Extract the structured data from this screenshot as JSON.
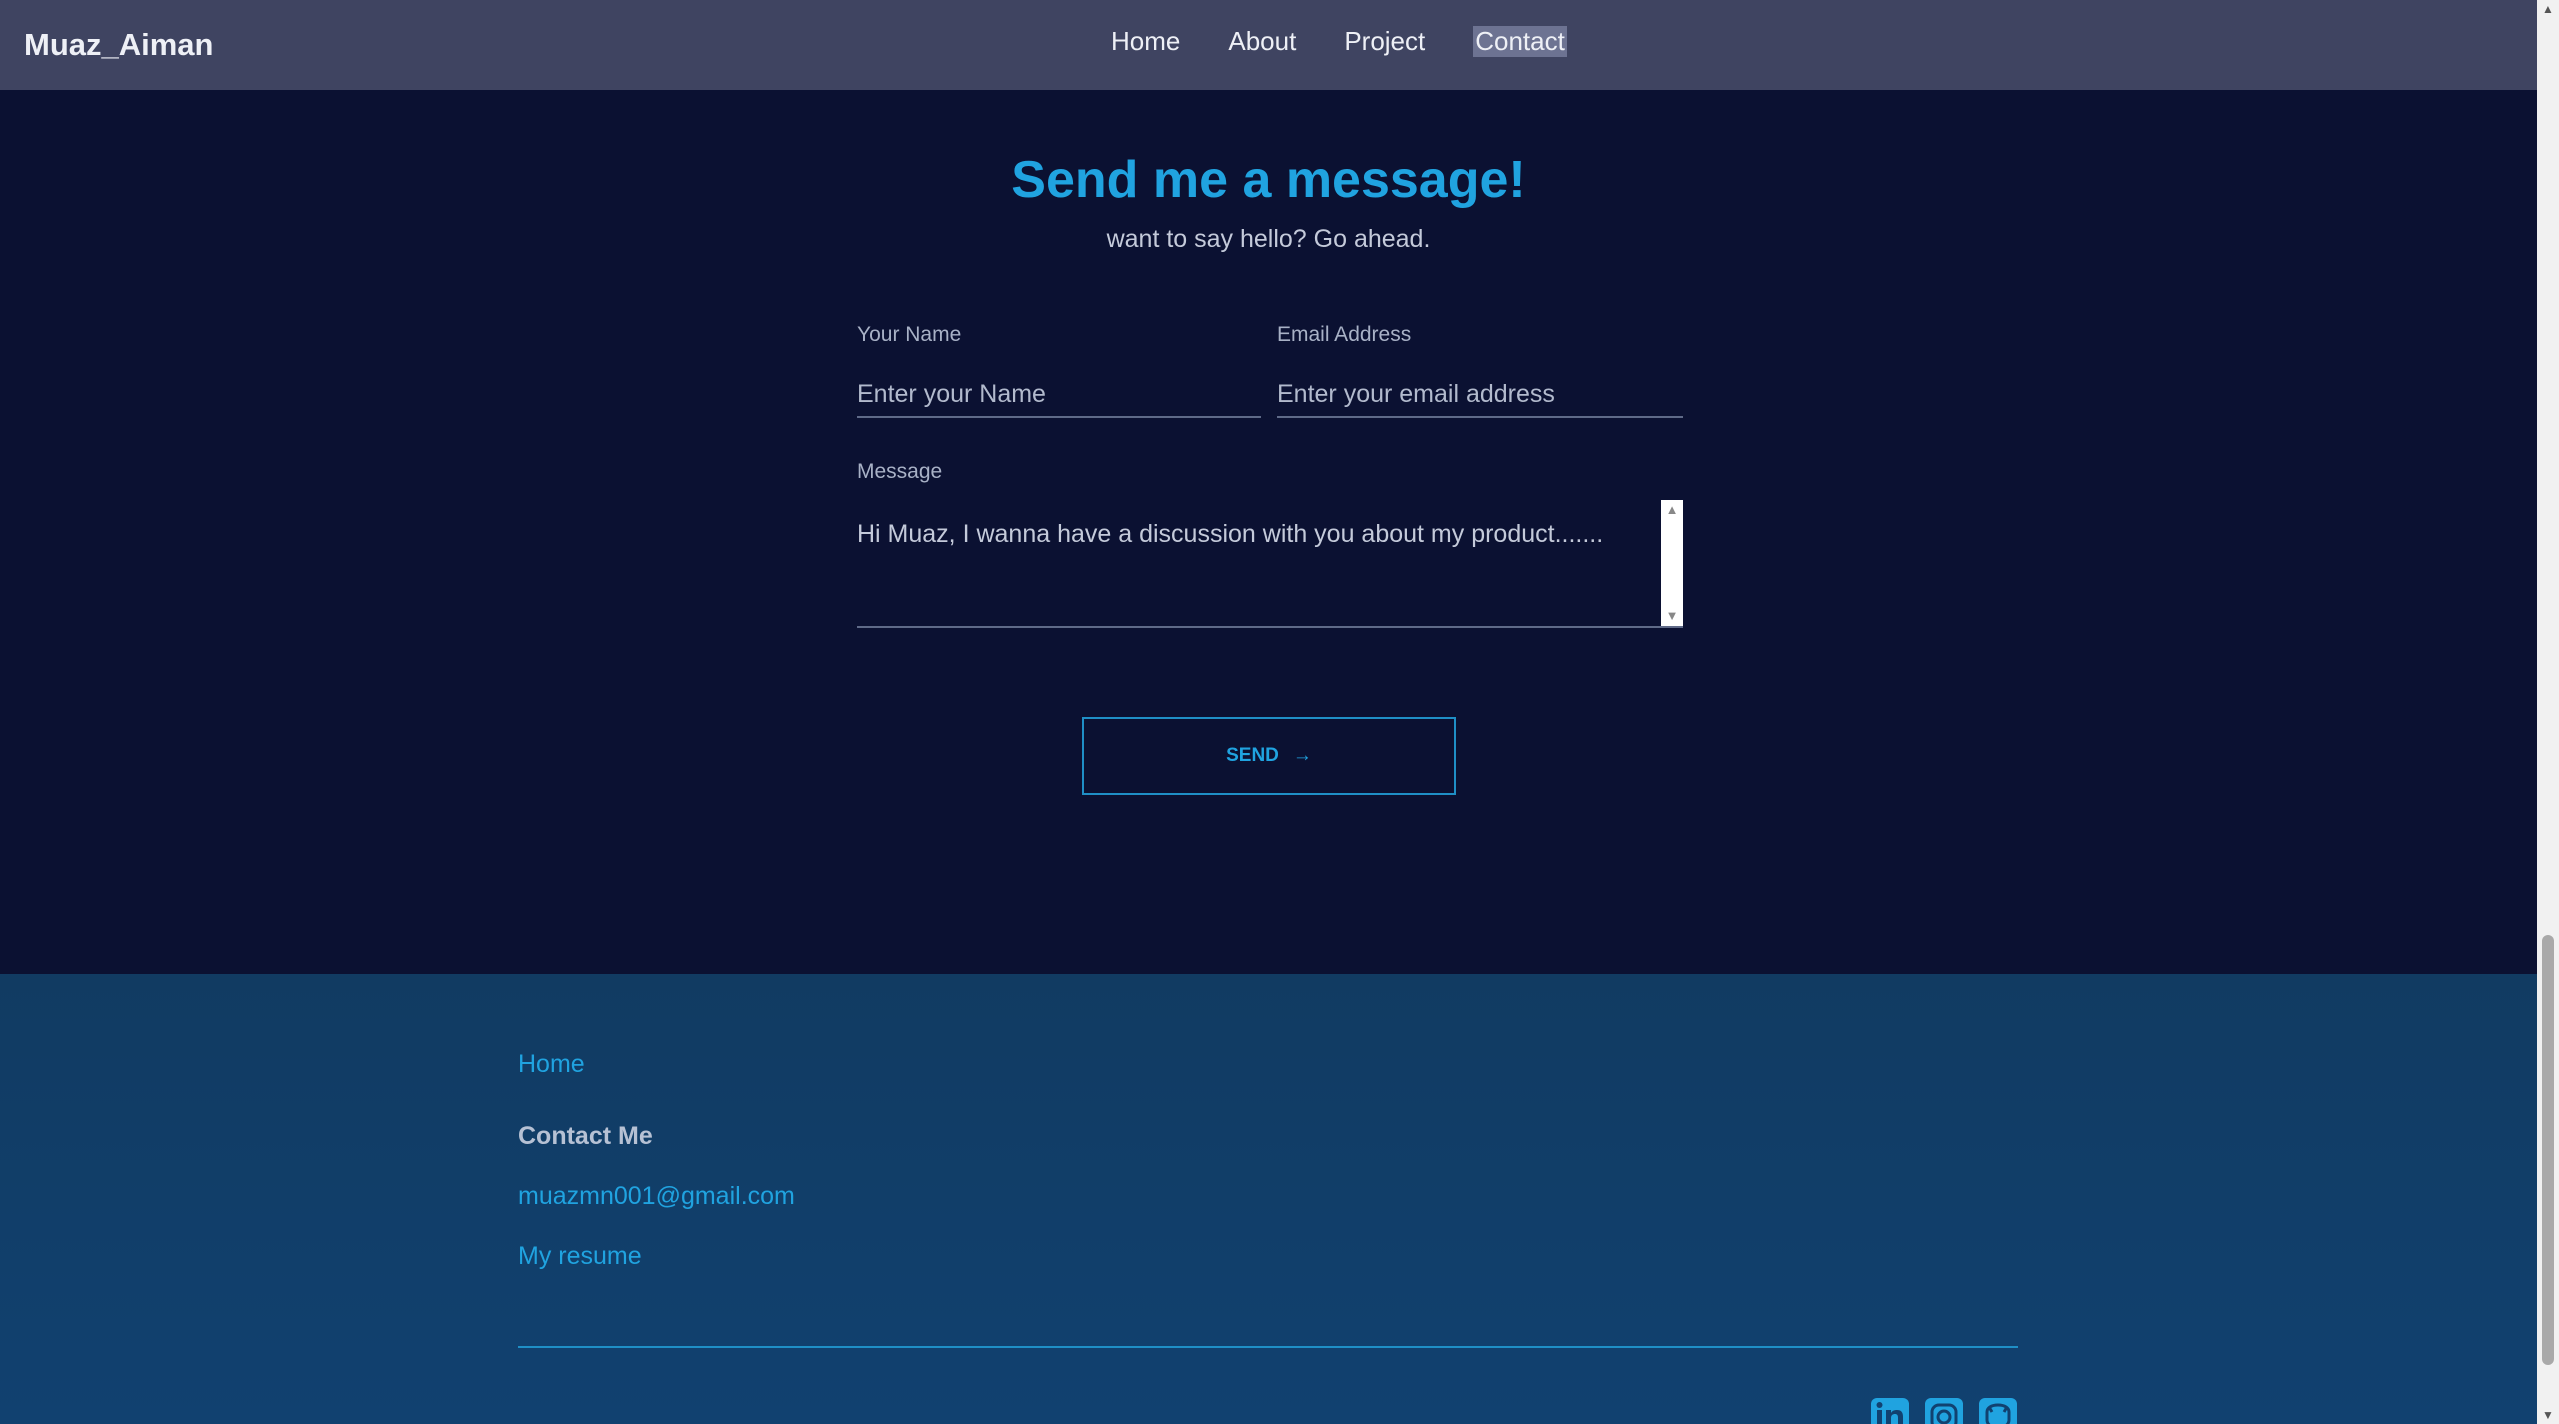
{
  "nav": {
    "brand": "Muaz_Aiman",
    "links": [
      "Home",
      "About",
      "Project",
      "Contact"
    ],
    "active": "Contact"
  },
  "contact": {
    "title": "Send me a message!",
    "subtitle": "want to say hello? Go ahead.",
    "name_label": "Your Name",
    "name_placeholder": "Enter your Name",
    "email_label": "Email Address",
    "email_placeholder": "Enter your email address",
    "message_label": "Message",
    "message_value": "Hi Muaz, I wanna have a discussion with you about my product.......",
    "send_label": "SEND",
    "send_arrow": "→"
  },
  "footer": {
    "home_link": "Home",
    "contact_heading": "Contact Me",
    "email": "muazmn001@gmail.com",
    "resume_link": "My resume",
    "social_icons": [
      "linkedin-icon",
      "instagram-icon",
      "github-icon"
    ]
  },
  "colors": {
    "accent": "#20a3e0",
    "nav_bg": "#3f4461",
    "page_bg": "#0b1132",
    "footer_bg": "#113b62"
  }
}
